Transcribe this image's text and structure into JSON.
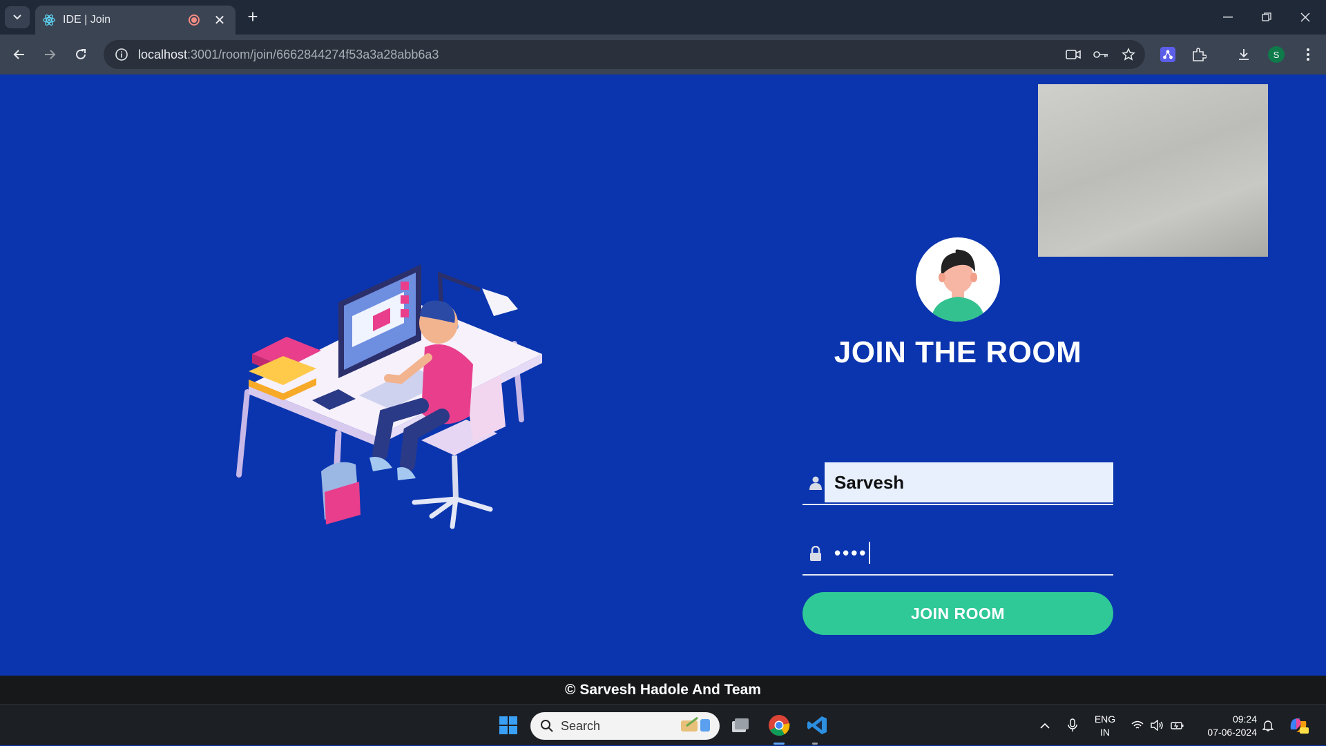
{
  "browser": {
    "tab_title": "IDE | Join",
    "url_host": "localhost",
    "url_rest": ":3001/room/join/6662844274f53a3a28abb6a3",
    "profile_initial": "S"
  },
  "form": {
    "title": "JOIN THE ROOM",
    "username_value": "Sarvesh",
    "password_masked": "••••",
    "submit_label": "JOIN ROOM"
  },
  "footer": {
    "text": "© Sarvesh Hadole And Team"
  },
  "taskbar": {
    "search_placeholder": "Search",
    "lang_line1": "ENG",
    "lang_line2": "IN",
    "time": "09:24",
    "date": "07-06-2024"
  },
  "colors": {
    "page_bg": "#0a35ae",
    "button": "#2fc897",
    "footer_bg": "#161819"
  }
}
